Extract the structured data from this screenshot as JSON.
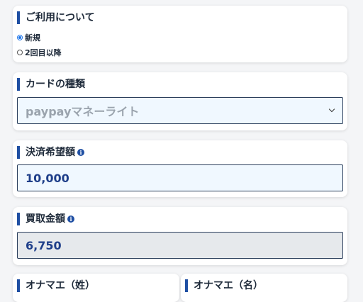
{
  "usage": {
    "title": "ご利用について",
    "options": [
      {
        "label": "新規",
        "checked": true
      },
      {
        "label": "2回目以降",
        "checked": false
      }
    ]
  },
  "card_type": {
    "title": "カードの種類",
    "selected": "paypayマネーライト"
  },
  "amount": {
    "title": "決済希望額",
    "info_icon": "info-icon",
    "value": "10,000"
  },
  "purchase": {
    "title": "買取金額",
    "info_icon": "info-icon",
    "value": "6,750"
  },
  "name": {
    "last_title": "オナマエ（姓）",
    "first_title": "オナマエ（名）"
  },
  "colors": {
    "accent": "#1f4fa3",
    "value_text": "#1f3f8a",
    "field_bg": "#f0f8ff",
    "readonly_bg": "#e6e9ec"
  }
}
